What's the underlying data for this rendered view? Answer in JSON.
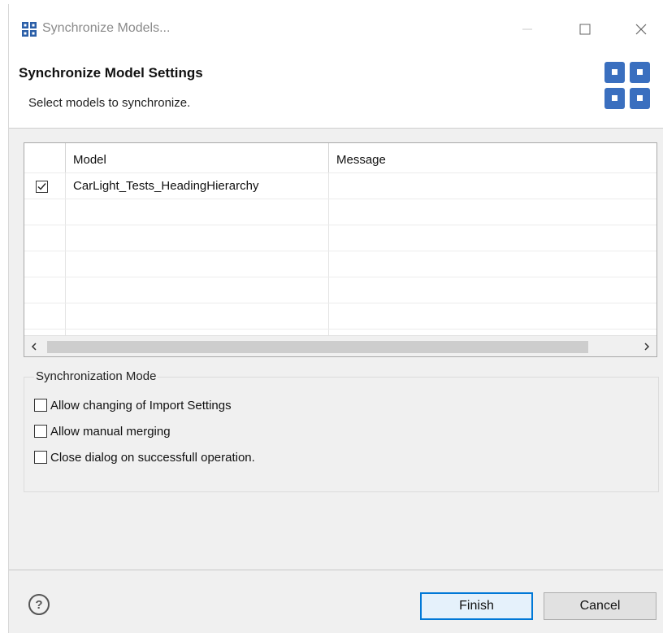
{
  "window": {
    "title": "Synchronize Models..."
  },
  "banner": {
    "title": "Synchronize Model Settings",
    "subtitle": "Select models to synchronize."
  },
  "table": {
    "columns": [
      "Model",
      "Message"
    ],
    "rows": [
      {
        "checked": true,
        "model": "CarLight_Tests_HeadingHierarchy",
        "message": ""
      }
    ]
  },
  "sync_mode": {
    "label": "Synchronization Mode",
    "options": [
      {
        "label": "Allow changing of Import Settings",
        "checked": false
      },
      {
        "label": "Allow manual merging",
        "checked": false
      },
      {
        "label": "Close dialog on successfull operation.",
        "checked": false
      }
    ]
  },
  "buttons": {
    "finish": "Finish",
    "cancel": "Cancel",
    "help": "?"
  },
  "icons": {
    "app": "grid-icon",
    "minimize": "minimize-icon",
    "maximize": "maximize-icon",
    "close": "close-icon",
    "banner": "model-grid-icon",
    "help": "help-icon"
  },
  "colors": {
    "accent": "#0078d7",
    "banner_icon": "#3a6fbf"
  }
}
